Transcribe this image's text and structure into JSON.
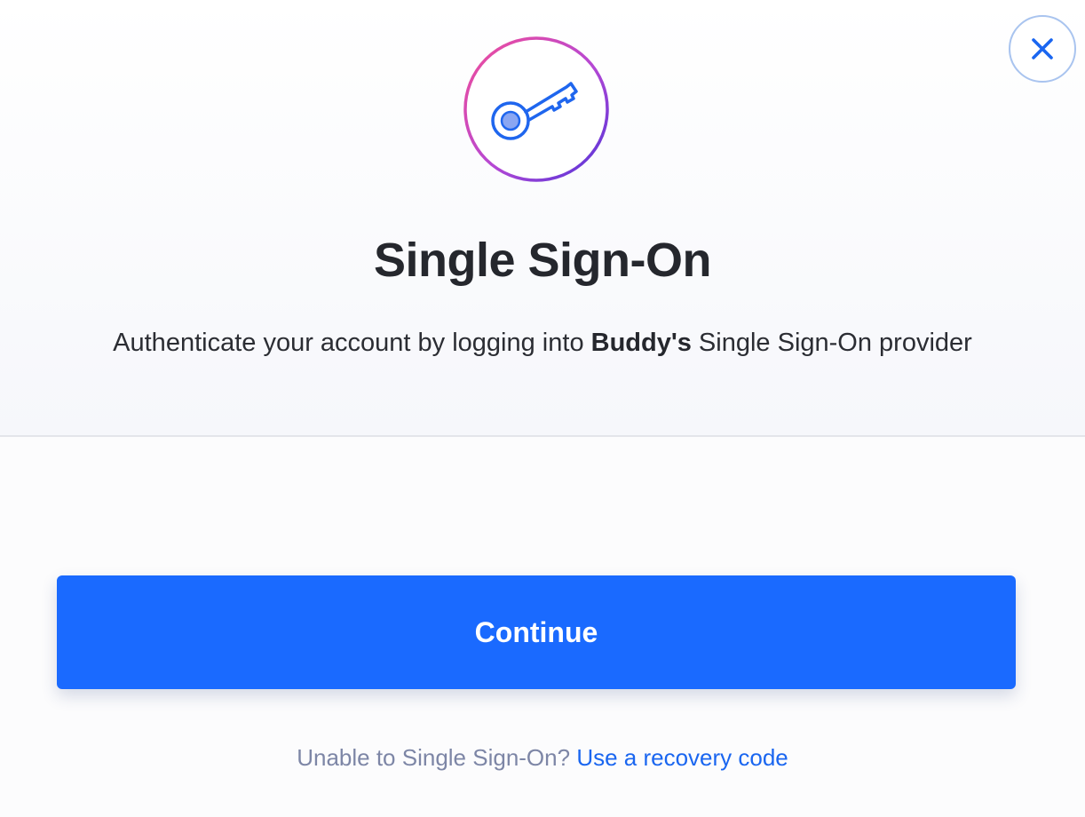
{
  "dialog": {
    "title": "Single Sign-On",
    "description": {
      "before": "Authenticate your account by logging into ",
      "org_name": "Buddy's",
      "after": " Single Sign-On provider"
    },
    "close_icon": "close-icon",
    "hero_icon": "key-icon"
  },
  "actions": {
    "continue_label": "Continue"
  },
  "footer": {
    "prompt": "Unable to Single Sign-On? ",
    "recovery_link": "Use a recovery code"
  },
  "colors": {
    "accent": "#1a6aff",
    "ring_start": "#f0509c",
    "ring_end": "#5a34e0",
    "link": "#1a66f0"
  }
}
